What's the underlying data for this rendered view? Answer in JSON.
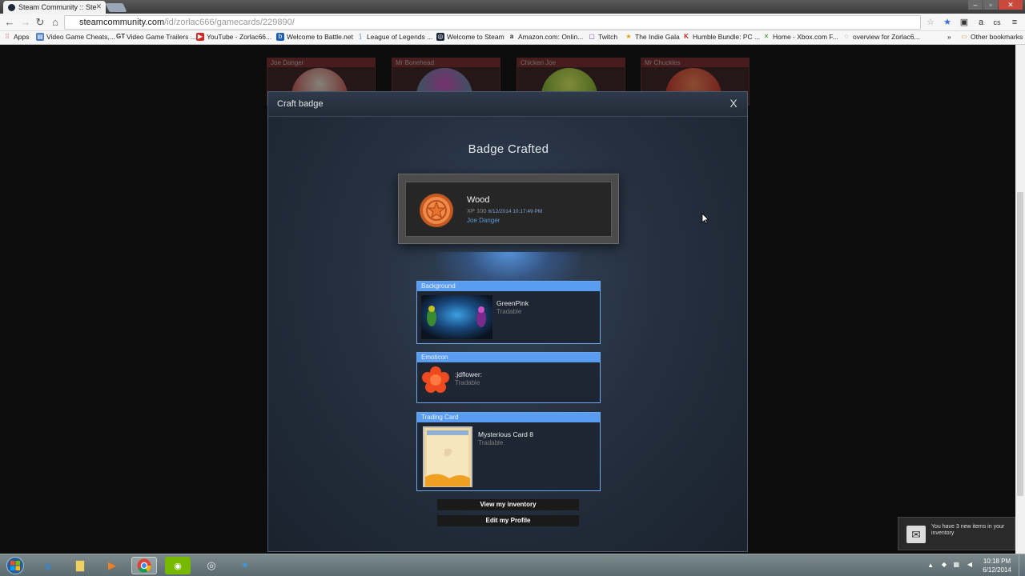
{
  "browser": {
    "tab_title": "Steam Community :: Ste",
    "url_host": "steamcommunity.com",
    "url_path": "/id/zorlac666/gamecards/229890/",
    "bookmarks": [
      {
        "label": "Apps",
        "icon": "apps-grid-icon"
      },
      {
        "label": "Video Game Cheats,...",
        "icon": "page-icon"
      },
      {
        "label": "Video Game Trailers ...",
        "icon": "gt-icon"
      },
      {
        "label": "YouTube - Zorlac66...",
        "icon": "youtube-icon"
      },
      {
        "label": "Welcome to Battle.net",
        "icon": "battlenet-icon"
      },
      {
        "label": "League of Legends ...",
        "icon": "lol-icon"
      },
      {
        "label": "Welcome to Steam",
        "icon": "steam-icon"
      },
      {
        "label": "Amazon.com: Onlin...",
        "icon": "amazon-icon"
      },
      {
        "label": "Twitch",
        "icon": "twitch-icon"
      },
      {
        "label": "The Indie Gala",
        "icon": "star-icon"
      },
      {
        "label": "Humble Bundle: PC ...",
        "icon": "humble-icon"
      },
      {
        "label": "Home - Xbox.com F...",
        "icon": "xbox-icon"
      },
      {
        "label": "overview for Zorlac6...",
        "icon": "reddit-icon"
      }
    ],
    "bookmarks_more": "»",
    "other_bookmarks": "Other bookmarks"
  },
  "background_cards": [
    {
      "name": "Joe Danger"
    },
    {
      "name": "Mr Bonehead"
    },
    {
      "name": "Chicken Joe"
    },
    {
      "name": "Mr Chuckles"
    }
  ],
  "modal": {
    "title": "Craft badge",
    "close_label": "X",
    "heading": "Badge Crafted",
    "badge": {
      "name": "Wood",
      "xp": "XP 100",
      "timestamp": "6/12/2014 10:17:49 PM",
      "game": "Joe Danger"
    },
    "items": [
      {
        "category": "Background",
        "name": "GreenPink",
        "status": "Tradable"
      },
      {
        "category": "Emoticon",
        "name": ":jdflower:",
        "status": "Tradable"
      },
      {
        "category": "Trading Card",
        "name": "Mysterious Card 8",
        "status": "Tradable"
      }
    ],
    "buttons": {
      "view_inventory": "View my inventory",
      "edit_profile": "Edit my Profile"
    }
  },
  "notification": {
    "text": "You have 3 new items in your inventory"
  },
  "taskbar": {
    "time": "10:18 PM",
    "date": "6/12/2014"
  },
  "colors": {
    "accent_blue": "#5a9cf0",
    "badge_orange": "#e87a3a",
    "link_blue": "#5a9ad8"
  }
}
